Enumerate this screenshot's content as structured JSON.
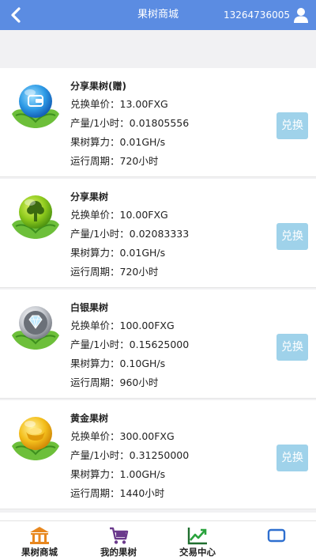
{
  "header": {
    "title": "果树商城",
    "phone": "13264736005",
    "back_icon": "chevron-left-icon",
    "user_icon": "user-icon",
    "color": "#5b8ce2"
  },
  "items": [
    {
      "name": "分享果树(赠)",
      "price": "兑换单价：13.00FXG",
      "output": "产量/1小时：0.01805556",
      "power": "果树算力：0.01GH/s",
      "cycle": "运行周期：720小时",
      "button": "兑换",
      "icon": "blue-fruit-wallet-icon"
    },
    {
      "name": "分享果树",
      "price": "兑换单价：10.00FXG",
      "output": "产量/1小时：0.02083333",
      "power": "果树算力：0.01GH/s",
      "cycle": "运行周期：720小时",
      "button": "兑换",
      "icon": "green-fruit-tree-icon"
    },
    {
      "name": "白银果树",
      "price": "兑换单价：100.00FXG",
      "output": "产量/1小时：0.15625000",
      "power": "果树算力：0.10GH/s",
      "cycle": "运行周期：960小时",
      "button": "兑换",
      "icon": "silver-fruit-diamond-icon"
    },
    {
      "name": "黄金果树",
      "price": "兑换单价：300.00FXG",
      "output": "产量/1小时：0.31250000",
      "power": "果树算力：1.00GH/s",
      "cycle": "运行周期：1440小时",
      "button": "兑换",
      "icon": "gold-fruit-ingot-icon"
    }
  ],
  "tabs": [
    {
      "label": "果树商城",
      "icon": "bank-icon"
    },
    {
      "label": "我的果树",
      "icon": "cart-icon"
    },
    {
      "label": "交易中心",
      "icon": "chart-icon"
    },
    {
      "label": "",
      "icon": "rectangle-icon"
    }
  ]
}
